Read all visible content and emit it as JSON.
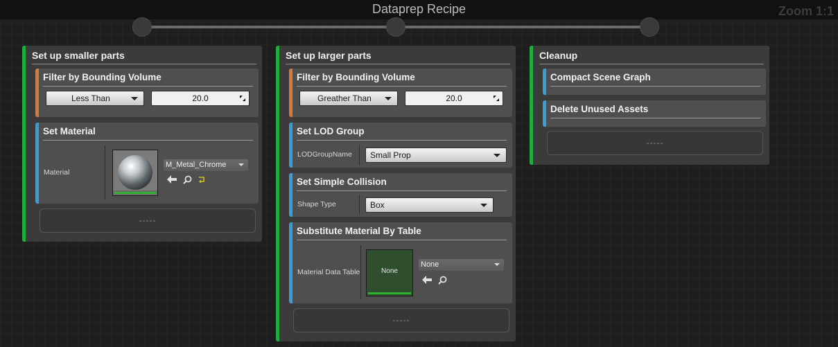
{
  "header": {
    "title": "Dataprep Recipe",
    "zoom": "Zoom 1:1"
  },
  "columns": [
    {
      "title": "Set up smaller parts",
      "filter": {
        "title": "Filter by Bounding Volume",
        "operator": "Less Than",
        "value": "20.0"
      },
      "set_material": {
        "title": "Set Material",
        "label": "Material",
        "asset": "M_Metal_Chrome"
      },
      "placeholder": "-----"
    },
    {
      "title": "Set up larger parts",
      "filter": {
        "title": "Filter by Bounding Volume",
        "operator": "Greather Than",
        "value": "20.0"
      },
      "lod": {
        "title": "Set LOD Group",
        "label": "LODGroupName",
        "value": "Small Prop"
      },
      "collision": {
        "title": "Set Simple Collision",
        "label": "Shape Type",
        "value": "Box"
      },
      "substitute": {
        "title": "Substitute Material By Table",
        "label": "Material Data Table",
        "thumb_text": "None",
        "asset": "None"
      },
      "placeholder": "-----"
    },
    {
      "title": "Cleanup",
      "compact": {
        "title": "Compact Scene Graph"
      },
      "delete_assets": {
        "title": "Delete Unused Assets"
      },
      "placeholder": "-----"
    }
  ],
  "colors": {
    "group_accent": "#1fae3e",
    "filter_accent": "#d57a3a",
    "operation_accent": "#3a9ed6"
  }
}
